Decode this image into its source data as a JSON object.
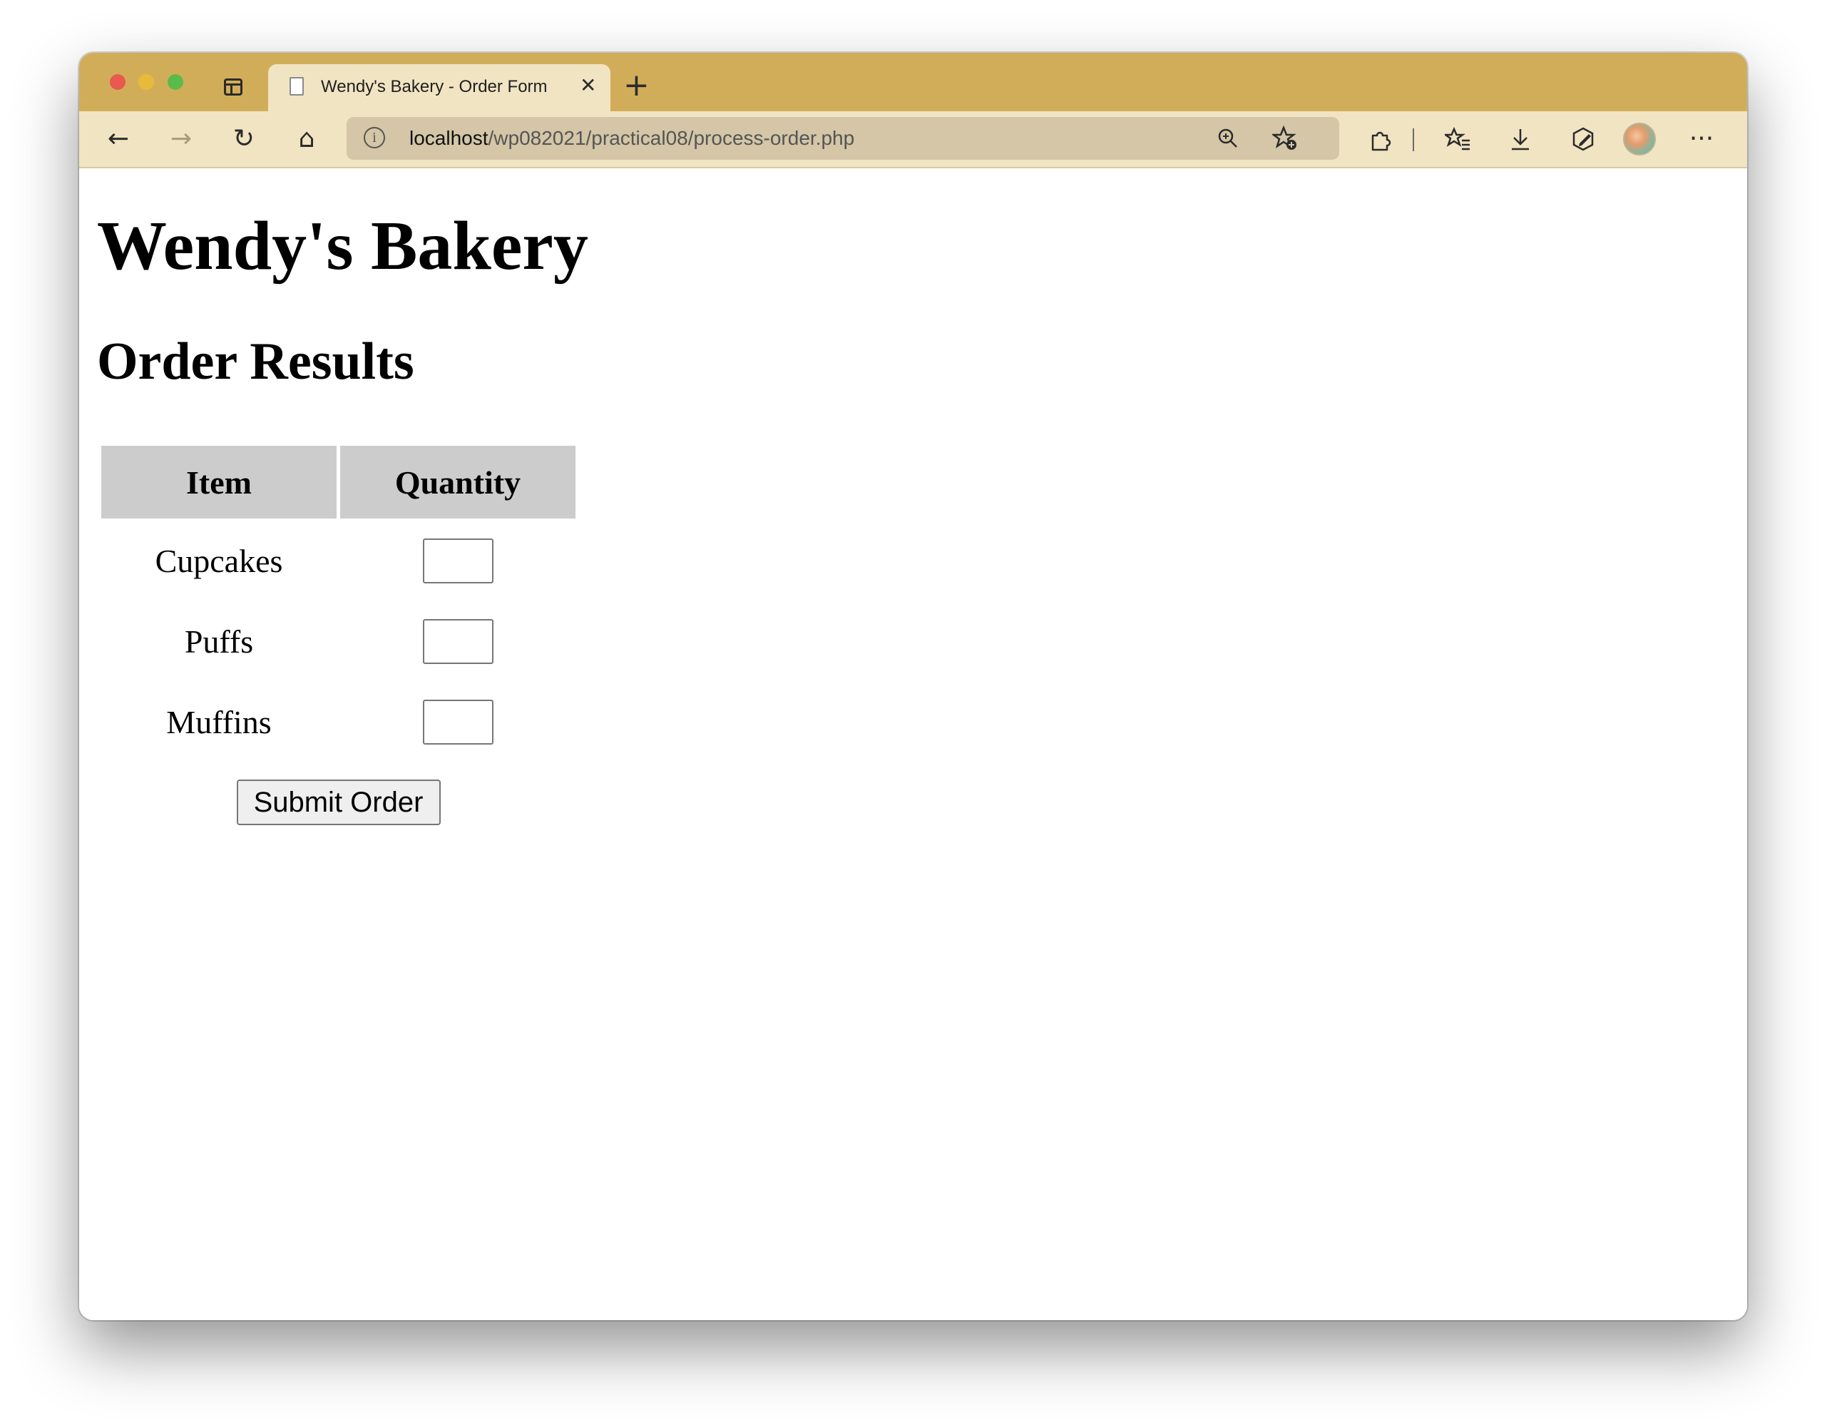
{
  "browser": {
    "tab": {
      "title": "Wendy's Bakery - Order Form",
      "close_glyph": "✕",
      "icon": "page-icon"
    },
    "new_tab_glyph": "+",
    "toolbar": {
      "back_glyph": "←",
      "forward_glyph": "→",
      "reload_glyph": "↻",
      "home_glyph": "⌂",
      "more_glyph": "···"
    },
    "address_bar": {
      "info_glyph": "i",
      "url_host": "localhost",
      "url_path": "/wp082021/practical08/process-order.php"
    },
    "icons": [
      "sidebar-tabs-icon",
      "back-icon",
      "forward-icon",
      "reload-icon",
      "home-icon",
      "zoom-icon",
      "add-favorite-icon",
      "extensions-icon",
      "favorites-icon",
      "downloads-icon",
      "performance-icon",
      "profile-avatar",
      "more-icon"
    ],
    "colors": {
      "tab_strip": "#d2ad59",
      "toolbar": "#f1e4c2",
      "address_bar": "#d4c6a6"
    }
  },
  "page": {
    "heading": "Wendy's Bakery",
    "subheading": "Order Results",
    "table": {
      "headers": [
        "Item",
        "Quantity"
      ],
      "rows": [
        {
          "item": "Cupcakes",
          "quantity": ""
        },
        {
          "item": "Puffs",
          "quantity": ""
        },
        {
          "item": "Muffins",
          "quantity": ""
        }
      ],
      "header_bg": "#cccccc"
    },
    "submit_label": "Submit Order"
  }
}
